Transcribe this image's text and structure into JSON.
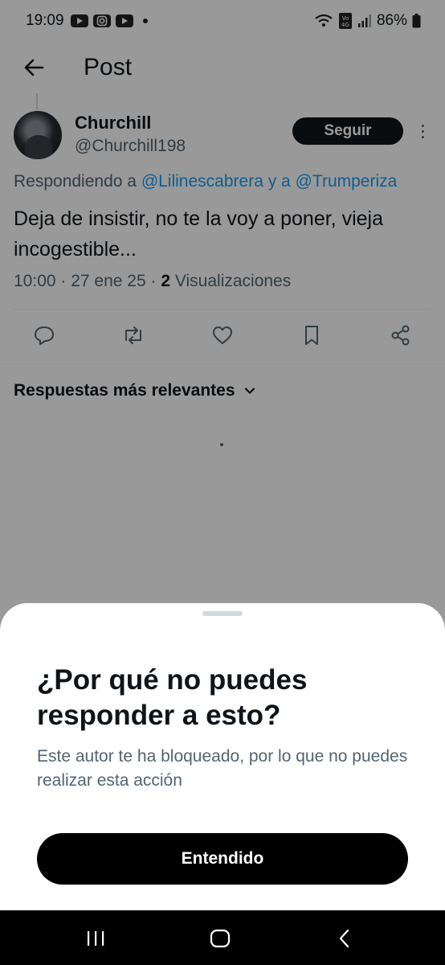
{
  "status_bar": {
    "time": "19:09",
    "apps": [
      "youtube-icon",
      "instagram-icon",
      "youtube-icon"
    ],
    "network": "VoLTE 4G",
    "battery": "86%"
  },
  "header": {
    "title": "Post"
  },
  "post": {
    "author_name": "Churchill",
    "author_handle": "@Churchill198",
    "follow_label": "Seguir",
    "replying_prefix": "Respondiendo a",
    "mention_1": "@Lilinescabrera",
    "replying_join": "y a",
    "mention_2": "@Trumperiza",
    "text": "Deja de insistir, no te la voy a poner, vieja incogestible...",
    "time": "10:00",
    "date": "27 ene 25",
    "views_count": "2",
    "views_label": "Visualizaciones"
  },
  "actions": [
    "reply-icon",
    "repost-icon",
    "like-icon",
    "bookmark-icon",
    "share-icon"
  ],
  "replies": {
    "sort_label": "Respuestas más relevantes"
  },
  "sheet": {
    "title": "¿Por qué no puedes responder a esto?",
    "body": "Este autor te ha bloqueado, por lo que no puedes realizar esta acción",
    "button_label": "Entendido"
  },
  "colors": {
    "accent": "#1d9bf0",
    "text": "#0f1419",
    "secondary": "#536471",
    "overlay": "rgba(0,0,0,0.4)"
  }
}
